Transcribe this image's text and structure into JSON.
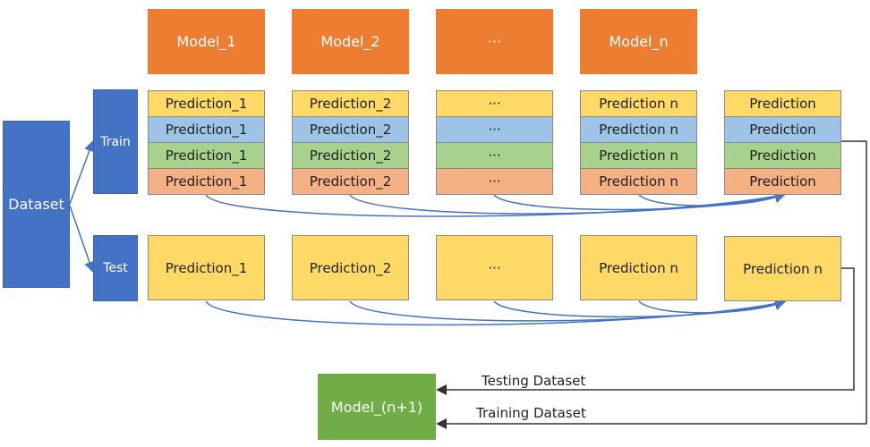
{
  "dataset": "Dataset",
  "train": "Train",
  "test": "Test",
  "models": [
    "Model_1",
    "Model_2",
    "···",
    "Model_n"
  ],
  "train_columns": [
    [
      "Prediction_1",
      "Prediction_1",
      "Prediction_1",
      "Prediction_1"
    ],
    [
      "Prediction_2",
      "Prediction_2",
      "Prediction_2",
      "Prediction_2"
    ],
    [
      "···",
      "···",
      "···",
      "···"
    ],
    [
      "Prediction n",
      "Prediction n",
      "Prediction n",
      "Prediction n"
    ],
    [
      "Prediction",
      "Prediction",
      "Prediction",
      "Prediction"
    ]
  ],
  "test_row": [
    "Prediction_1",
    "Prediction_2",
    "···",
    "Prediction n",
    "Prediction n"
  ],
  "final_model": "Model_(n+1)",
  "testing_dataset": "Testing Dataset",
  "training_dataset": "Training Dataset",
  "colors": {
    "model": "#ED7D31",
    "dataset": "#4472C4",
    "fold1": "#FFD966",
    "fold2": "#9DC3E6",
    "fold3": "#A9D18E",
    "fold4": "#F4B183",
    "final_model": "#70AD47",
    "arrows": "#4472C4"
  }
}
